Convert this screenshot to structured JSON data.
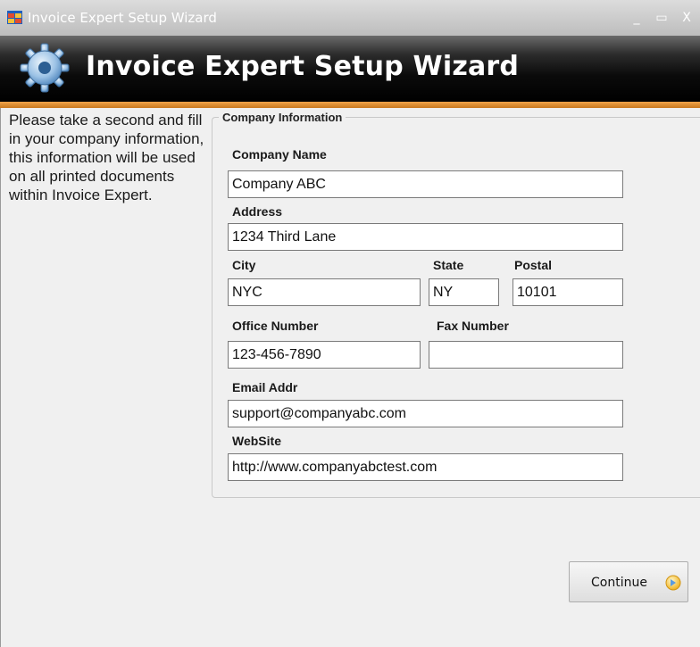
{
  "window": {
    "title": "Invoice Expert Setup Wizard",
    "controls": {
      "minimize": "_",
      "maximize": "▭",
      "close": "X"
    }
  },
  "banner": {
    "title": "Invoice Expert Setup Wizard",
    "icon": "gear-icon"
  },
  "intro_text": "Please take a second and fill in your company information, this information will be used on all printed documents within Invoice Expert.",
  "group": {
    "legend": "Company Information",
    "company_name": {
      "label": "Company Name",
      "value": "Company ABC"
    },
    "address": {
      "label": "Address",
      "value": "1234 Third Lane"
    },
    "city": {
      "label": "City",
      "value": "NYC"
    },
    "state": {
      "label": "State",
      "value": "NY"
    },
    "postal": {
      "label": "Postal",
      "value": "10101"
    },
    "office_number": {
      "label": "Office Number",
      "value": "123-456-7890"
    },
    "fax_number": {
      "label": "Fax Number",
      "value": ""
    },
    "email": {
      "label": "Email Addr",
      "value": "support@companyabc.com"
    },
    "website": {
      "label": "WebSite",
      "value": "http://www.companyabctest.com"
    }
  },
  "continue_button": {
    "label": "Continue",
    "icon": "arrow-right-icon"
  },
  "colors": {
    "accent_orange": "#e8963a",
    "banner_black": "#0b0b0b",
    "background": "#f0f0f0"
  }
}
